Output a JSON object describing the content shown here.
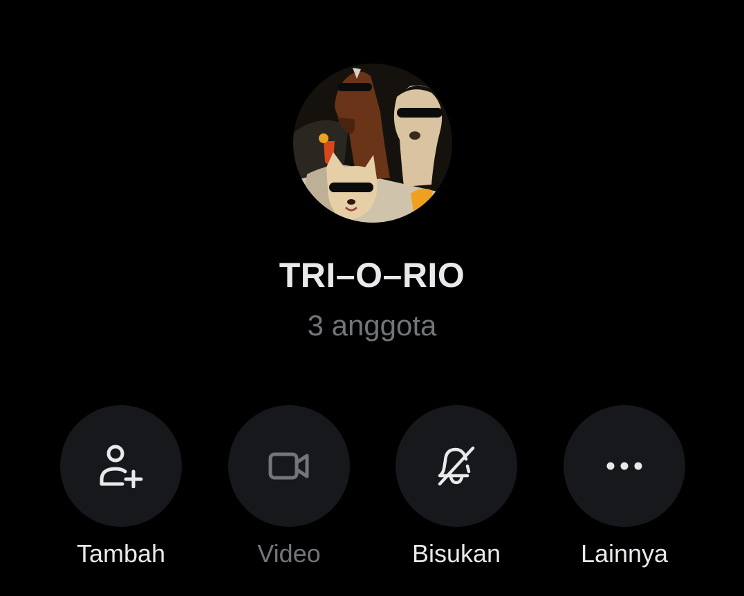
{
  "group": {
    "name": "TRI–O–RIO",
    "members": "3 anggota"
  },
  "actions": [
    {
      "label": "Tambah",
      "icon": "add-person-icon",
      "enabled": true
    },
    {
      "label": "Video",
      "icon": "video-camera-icon",
      "enabled": false
    },
    {
      "label": "Bisukan",
      "icon": "bell-muted-icon",
      "enabled": true
    },
    {
      "label": "Lainnya",
      "icon": "more-dots-icon",
      "enabled": true
    }
  ],
  "colors": {
    "background": "#000000",
    "button": "#16181c",
    "text_primary": "#e7e9ea",
    "text_secondary": "#71767b"
  }
}
